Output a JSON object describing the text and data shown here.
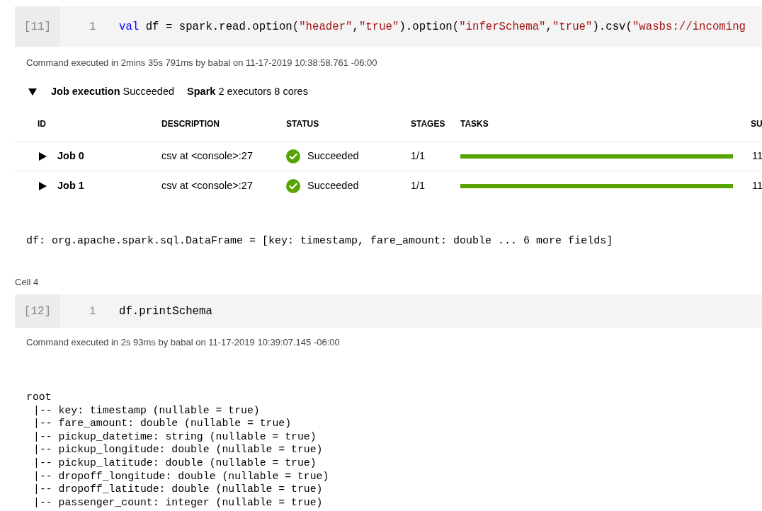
{
  "cells": [
    {
      "execution_count": "[11]",
      "lines": [
        {
          "number": "1",
          "tokens": [
            {
              "kind": "keyword",
              "text": "val"
            },
            {
              "kind": "plain",
              "text": " df = spark.read.option("
            },
            {
              "kind": "string",
              "text": "\"header\""
            },
            {
              "kind": "plain",
              "text": ","
            },
            {
              "kind": "string",
              "text": "\"true\""
            },
            {
              "kind": "plain",
              "text": ").option("
            },
            {
              "kind": "string",
              "text": "\"inferSchema\""
            },
            {
              "kind": "plain",
              "text": ","
            },
            {
              "kind": "string",
              "text": "\"true\""
            },
            {
              "kind": "plain",
              "text": ").csv("
            },
            {
              "kind": "string",
              "text": "\"wasbs://incoming"
            }
          ]
        }
      ],
      "command_status": "Command executed in 2mins 35s 791ms by babal on 11-17-2019 10:38:58.761 -06:00",
      "job_execution": {
        "expanded": true,
        "label": "Job execution",
        "status": "Succeeded",
        "spark_label": "Spark",
        "spark_info": "2 executors 8 cores"
      },
      "jobs_table": {
        "columns": [
          "ID",
          "DESCRIPTION",
          "STATUS",
          "STAGES",
          "TASKS",
          "SU"
        ],
        "rows": [
          {
            "expanded": false,
            "id": "Job 0",
            "description": "csv at <console>:27",
            "status": {
              "kind": "success",
              "text": "Succeeded"
            },
            "stages": "1/1",
            "tasks": {
              "level": 1
            },
            "column_6": "11"
          },
          {
            "expanded": false,
            "id": "Job 1",
            "description": "csv at <console>:27",
            "status": {
              "kind": "success",
              "text": "Succeeded"
            },
            "stages": "1/1",
            "tasks": {
              "level": 1
            },
            "column_6": "11"
          }
        ]
      },
      "output": {
        "kind": "text",
        "text": "df: org.apache.spark.sql.DataFrame = [key: timestamp, fare_amount: double ... 6 more fields]"
      }
    },
    {
      "label": "Cell 4",
      "execution_count": "[12]",
      "lines": [
        {
          "number": "1",
          "tokens": [
            {
              "kind": "plain",
              "text": "df.printSchema"
            }
          ]
        }
      ],
      "command_status": "Command executed in 2s 93ms by babal on 11-17-2019 10:39:07.145 -06:00",
      "output": {
        "kind": "tree",
        "root": {
          "text": "root",
          "children": [
            {
              "text": "|-- key: timestamp (nullable = true)"
            },
            {
              "text": "|-- fare_amount: double (nullable = true)"
            },
            {
              "text": "|-- pickup_datetime: string (nullable = true)"
            },
            {
              "text": "|-- pickup_longitude: double (nullable = true)"
            },
            {
              "text": "|-- pickup_latitude: double (nullable = true)"
            },
            {
              "text": "|-- dropoff_longitude: double (nullable = true)"
            },
            {
              "text": "|-- dropoff_latitude: double (nullable = true)"
            },
            {
              "text": "|-- passenger_count: integer (nullable = true)"
            }
          ]
        }
      }
    }
  ]
}
